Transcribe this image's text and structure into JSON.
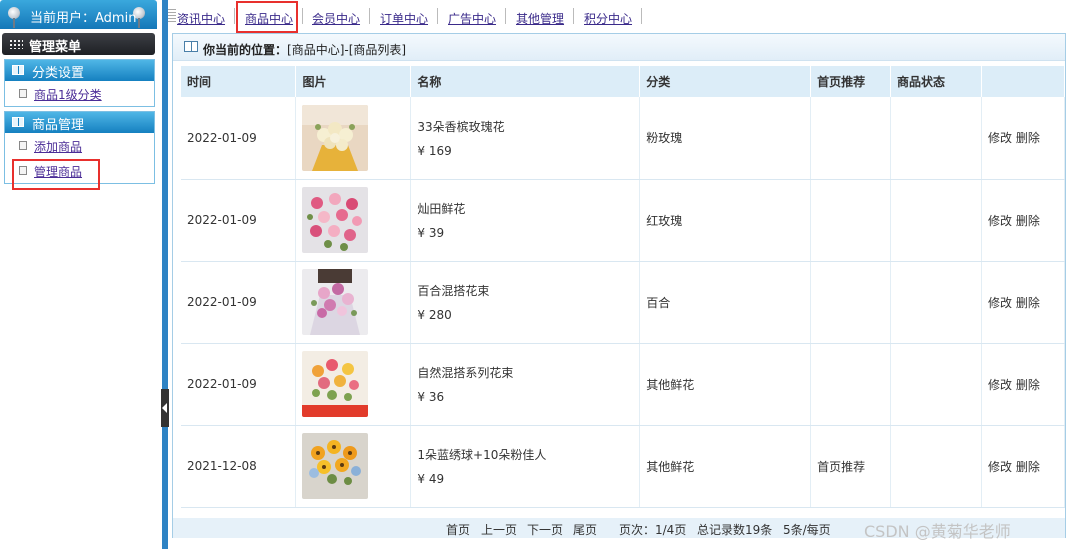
{
  "user": {
    "label": "当前用户：Admin"
  },
  "sidebar": {
    "menu_title": "管理菜单",
    "groups": [
      {
        "title": "分类设置",
        "items": [
          {
            "label": "商品1级分类"
          }
        ]
      },
      {
        "title": "商品管理",
        "items": [
          {
            "label": "添加商品"
          },
          {
            "label": "管理商品"
          }
        ]
      }
    ]
  },
  "topnav": {
    "items": [
      {
        "label": "资讯中心"
      },
      {
        "label": "商品中心"
      },
      {
        "label": "会员中心"
      },
      {
        "label": "订单中心"
      },
      {
        "label": "广告中心"
      },
      {
        "label": "其他管理"
      },
      {
        "label": "积分中心"
      }
    ]
  },
  "breadcrumb": {
    "prefix": "你当前的位置：",
    "path": "[商品中心]-[商品列表]"
  },
  "table": {
    "headers": [
      "时间",
      "图片",
      "名称",
      "分类",
      "首页推荐",
      "商品状态",
      ""
    ],
    "rows": [
      {
        "date": "2022-01-09",
        "name": "33朵香槟玫瑰花",
        "price": "¥ 169",
        "category": "粉玫瑰",
        "featured": "",
        "status": "",
        "edit": "修改",
        "delete": "删除"
      },
      {
        "date": "2022-01-09",
        "name": "灿田鲜花",
        "price": "¥ 39",
        "category": "红玫瑰",
        "featured": "",
        "status": "",
        "edit": "修改",
        "delete": "删除"
      },
      {
        "date": "2022-01-09",
        "name": "百合混搭花束",
        "price": "¥ 280",
        "category": "百合",
        "featured": "",
        "status": "",
        "edit": "修改",
        "delete": "删除"
      },
      {
        "date": "2022-01-09",
        "name": "自然混搭系列花束",
        "price": "¥ 36",
        "category": "其他鲜花",
        "featured": "",
        "status": "",
        "edit": "修改",
        "delete": "删除"
      },
      {
        "date": "2021-12-08",
        "name": "1朵蓝绣球+10朵粉佳人",
        "price": "¥ 49",
        "category": "其他鲜花",
        "featured": "首页推荐",
        "status": "",
        "edit": "修改",
        "delete": "删除"
      }
    ]
  },
  "pager": {
    "first": "首页",
    "prev": "上一页",
    "next": "下一页",
    "last": "尾页",
    "page_info": "页次：1/4页",
    "total": "总记录数19条",
    "per_page": "5条/每页"
  },
  "watermark": "CSDN @黄菊华老师",
  "colors": {
    "accent": "#1a86c7",
    "highlight_box": "#e8302d",
    "link": "#3a2a8a"
  }
}
